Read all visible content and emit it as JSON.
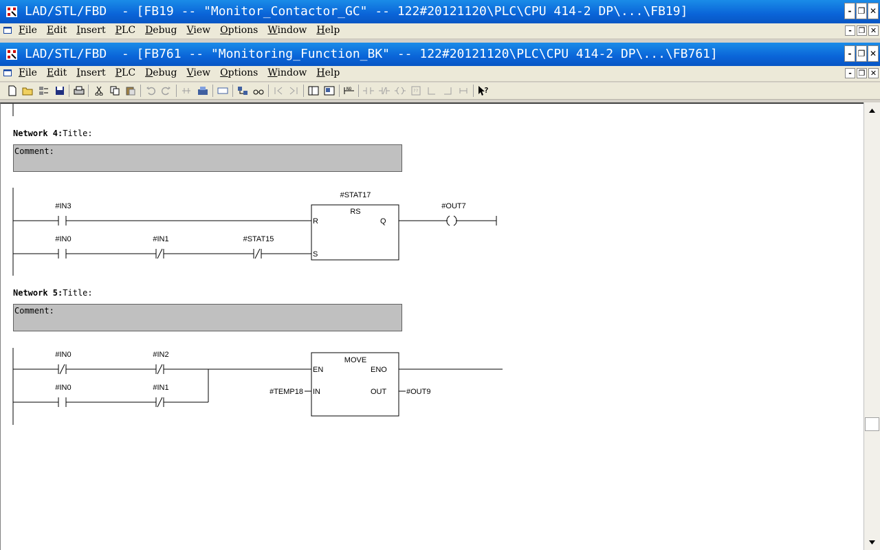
{
  "window1": {
    "title": "LAD/STL/FBD  - [FB19 -- \"Monitor_Contactor_GC\" -- 122#20121120\\PLC\\CPU 414-2 DP\\...\\FB19]"
  },
  "window2": {
    "title": "LAD/STL/FBD  - [FB761 -- \"Monitoring_Function_BK\" -- 122#20121120\\PLC\\CPU 414-2 DP\\...\\FB761]"
  },
  "menu": [
    "File",
    "Edit",
    "Insert",
    "PLC",
    "Debug",
    "View",
    "Options",
    "Window",
    "Help"
  ],
  "window_buttons": {
    "minimize": "-",
    "restore": "❐",
    "close": "✕"
  },
  "networks": [
    {
      "label": "Network 4",
      "title_label": "Title:",
      "comment": "Comment:",
      "contacts": [
        {
          "name": "#IN3",
          "type": "NO"
        },
        {
          "name": "#IN0",
          "type": "NO"
        },
        {
          "name": "#IN1",
          "type": "NC"
        },
        {
          "name": "#STAT15",
          "type": "NC"
        }
      ],
      "block": {
        "instance": "#STAT17",
        "type": "RS",
        "pins": {
          "r": "R",
          "s": "S",
          "q": "Q"
        }
      },
      "coil": {
        "name": "#OUT7",
        "symbol": "( )"
      }
    },
    {
      "label": "Network 5",
      "title_label": "Title:",
      "comment": "Comment:",
      "contacts": [
        {
          "name": "#IN0",
          "type": "NC"
        },
        {
          "name": "#IN2",
          "type": "NC"
        },
        {
          "name": "#IN0",
          "type": "NO"
        },
        {
          "name": "#IN1",
          "type": "NC"
        }
      ],
      "block": {
        "type": "MOVE",
        "pins": {
          "en": "EN",
          "eno": "ENO",
          "in": "IN",
          "out": "OUT"
        },
        "in_operand": "#TEMP18",
        "out_operand": "#OUT9"
      }
    }
  ],
  "colors": {
    "titlebar": "#0a64d8",
    "comment_bg": "#c0c0c0",
    "menubar": "#ece9d8"
  }
}
